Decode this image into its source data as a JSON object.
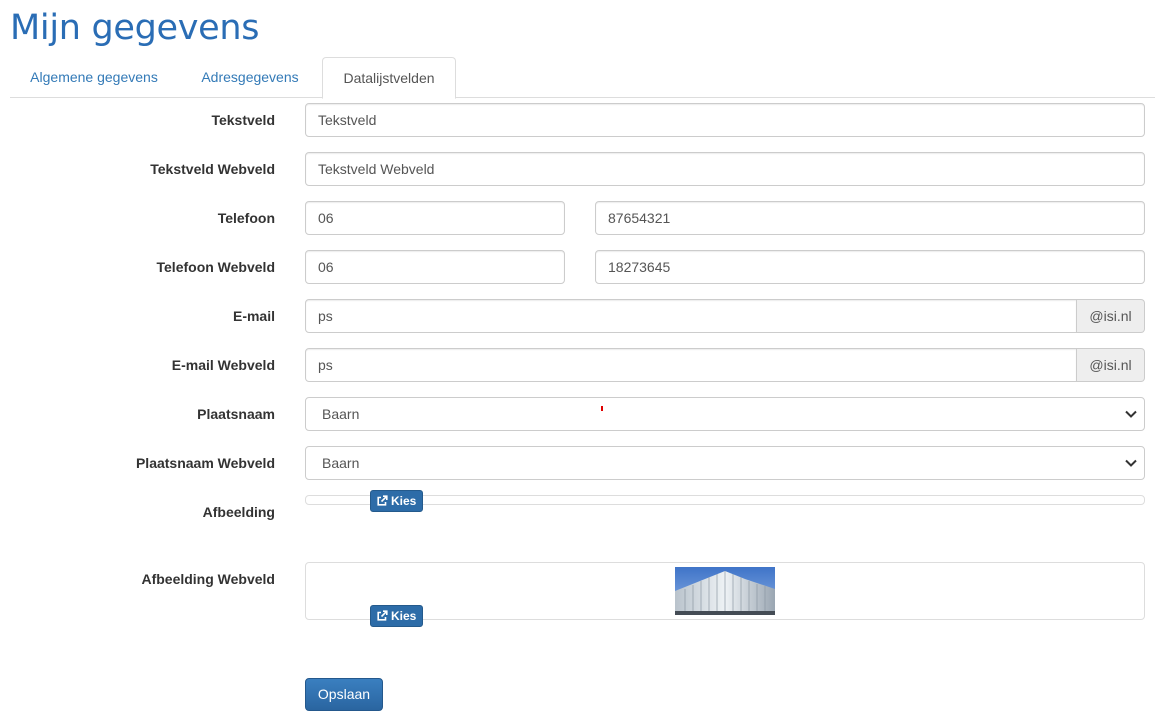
{
  "page": {
    "title": "Mijn gegevens"
  },
  "tabs": [
    {
      "label": "Algemene gegevens",
      "active": false
    },
    {
      "label": "Adresgegevens",
      "active": false
    },
    {
      "label": "Datalijstvelden",
      "active": true
    }
  ],
  "form": {
    "tekstveld": {
      "label": "Tekstveld",
      "value": "Tekstveld"
    },
    "tekstveld_webveld": {
      "label": "Tekstveld Webveld",
      "value": "Tekstveld Webveld"
    },
    "telefoon": {
      "label": "Telefoon",
      "prefix": "06",
      "number": "87654321"
    },
    "telefoon_webveld": {
      "label": "Telefoon Webveld",
      "prefix": "06",
      "number": "18273645"
    },
    "email": {
      "label": "E-mail",
      "value": "ps",
      "domain": "@isi.nl"
    },
    "email_webveld": {
      "label": "E-mail Webveld",
      "value": "ps",
      "domain": "@isi.nl"
    },
    "plaatsnaam": {
      "label": "Plaatsnaam",
      "selected": "Baarn"
    },
    "plaatsnaam_webveld": {
      "label": "Plaatsnaam Webveld",
      "selected": "Baarn"
    },
    "afbeelding": {
      "label": "Afbeelding",
      "button": "Kies"
    },
    "afbeelding_webveld": {
      "label": "Afbeelding Webveld",
      "button": "Kies"
    },
    "save_label": "Opslaan"
  },
  "colors": {
    "accent": "#2a6db5",
    "link": "#337ab7",
    "button": "#2d6ca8",
    "mark": "#e00000"
  },
  "icons": {
    "select": "chevron-down-icon",
    "kies": "external-link-icon"
  }
}
